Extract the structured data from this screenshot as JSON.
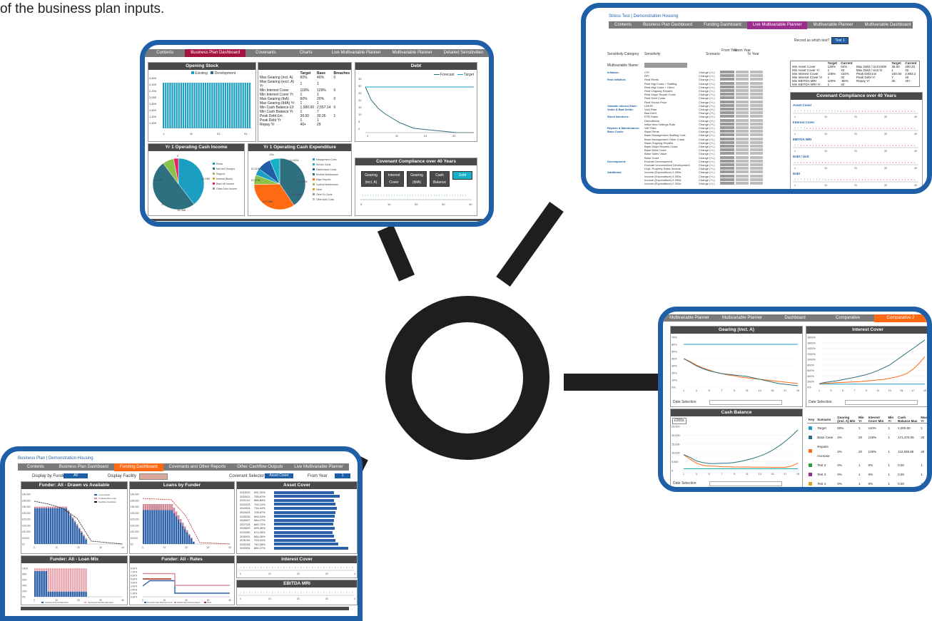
{
  "headline": "of the business plan inputs.",
  "colors": {
    "border": "#1f5fa8",
    "teal": "#1a8fa8",
    "orange": "#ff6a13",
    "dark": "#4a4a4a",
    "grey": "#7a7a7a",
    "pink": "#d98a95",
    "green": "#2e9e3e"
  },
  "card_dashboard": {
    "tabs": [
      "Contents",
      "Business Plan Dashboard",
      "Covenants",
      "Charts",
      "Live Multivariable Planner",
      "Multivariable Planner",
      "Detailed Sensitivities"
    ],
    "opening_stock": {
      "title": "Opening Stock",
      "legend": [
        "Existing",
        "Development"
      ],
      "y_ticks": [
        "2,600",
        "2,400",
        "2,200",
        "2,000",
        "1,800",
        "1,600",
        "1,400",
        "1,200"
      ],
      "x_ticks": [
        "1",
        "11",
        "21",
        "31"
      ]
    },
    "covenants": {
      "headers": [
        "Target",
        "Base",
        "Breaches"
      ],
      "rows": [
        [
          "Max Gearing (incl. A)",
          "60%",
          "40%",
          "0"
        ],
        [
          "Max Gearing (excl. A) Yr",
          "1",
          "1",
          ""
        ],
        [
          "Min Interest Cover",
          "110%",
          "129%",
          "0"
        ],
        [
          "Min Interest Cover Yr",
          "1",
          "1",
          ""
        ],
        [
          "Max Gearing (IbA)",
          "60%",
          "20%",
          "0"
        ],
        [
          "Max Gearing (IbfA) Yr",
          "1",
          "1",
          ""
        ],
        [
          "Min Cash Balance £0",
          "1,000.00",
          "2,557.14",
          "0"
        ],
        [
          "Min Cash Balance Yr",
          "1",
          "7",
          ""
        ],
        [
          "Peak Debt £m",
          "30.00",
          "30.26",
          "1"
        ],
        [
          "Peak Debt Yr",
          "1",
          "1",
          ""
        ],
        [
          "Repay Yr",
          "40+",
          "29",
          ""
        ]
      ]
    },
    "debt": {
      "title": "Debt",
      "legend": [
        "Forecast",
        "Target"
      ],
      "y_ticks": [
        "35",
        "30",
        "25",
        "20",
        "15",
        "10",
        "5",
        "0"
      ],
      "x_ticks": [
        "1",
        "11",
        "21",
        "31"
      ]
    },
    "income": {
      "title": "Yr 1 Operating Cash Income",
      "legend": [
        "Rents",
        "Net Net Charges",
        "Support",
        "Interest (Bank)",
        "Bank Mf Income",
        "Other Adm Income"
      ],
      "labels": [
        "2,207",
        "12,089",
        "15,368",
        "20",
        "0"
      ]
    },
    "expenditure": {
      "title": "Yr 1 Operating Cash Expenditure",
      "legend": [
        "Management Costs",
        "Service Costs",
        "Maintenance Costs",
        "Routine Maintenance",
        "Major Repairs",
        "Cyclical Maintenance",
        "Other",
        "Other Ex Costs",
        "Other Adm Costs"
      ],
      "labels": [
        "£1,600k",
        "£3,296k",
        "£2,318k",
        "£15,366k",
        "£12,889k",
        "£0k",
        "£2,378k"
      ]
    },
    "compliance": {
      "title": "Covenant Compliance over 40 Years",
      "buttons": [
        "Gearing (incl. A)",
        "Interest Cover",
        "Gearing (ibfA)",
        "Cash Balance",
        "Debt"
      ],
      "x_ticks": [
        "0",
        "10",
        "20",
        "30",
        "40"
      ]
    }
  },
  "card_stress": {
    "breadcrumb": "Stress Test",
    "org": "Demonstration Housing",
    "tabs": [
      "Contents",
      "Business Plan Dashboard",
      "Funding Dashboard",
      "Live Multivariable Planner",
      "Multivariable Planner",
      "Multivariable Dashboard"
    ],
    "record_label": "Record as which test?",
    "record_button": "Test 1",
    "col_headers": [
      "Sensitivity Category",
      "Sensitivity",
      "Scenario",
      "From Year",
      "From Year",
      "To Year"
    ],
    "multivariable_name": "Multivariable Name:",
    "sub_headers": [
      "Change 1",
      "Change 2",
      "Change 1 applied",
      "Change 2 applied"
    ],
    "categories": [
      {
        "cat": "Inflation:",
        "items": [
          "CPI",
          "RPI"
        ]
      },
      {
        "cat": "Real Inflation:",
        "items": [
          "Real Rents",
          "Real Mgt Costs + Staffing",
          "Real Mgt Costs + Other",
          "Real Ongoing Repairs",
          "Real Major Repair Costs",
          "Real Debt Costs",
          "Real House Price"
        ]
      },
      {
        "cat": "Variable Interest Rate:",
        "items": [
          "LIBOR"
        ]
      },
      {
        "cat": "Voids & Bad Debts:",
        "items": [
          "Void Rate",
          "Bad Debt"
        ]
      },
      {
        "cat": "Stock Numbers:",
        "items": [
          "RTB Sales",
          "Demolitions",
          "Initial New Lettings Rate"
        ]
      },
      {
        "cat": "Repairs & Maintenance:",
        "items": [
          "VAT Rate"
        ]
      },
      {
        "cat": "Base Costs:",
        "items": [
          "Base Rents",
          "Base Management Staffing Cost",
          "Base Management Other Costs",
          "Base Ongoing Repairs",
          "Base Major Repairs Costs",
          "Base Build Costs",
          "Base Sales Value",
          "Base Grant"
        ]
      },
      {
        "cat": "Development:",
        "items": [
          "Exclude Development",
          "Exclude Uncommitted Development",
          "Dvpt. Property Sales Income"
        ]
      },
      {
        "cat": "Additional",
        "items": [
          "Income (Expenditure) £ 000s",
          "Income (Expenditure) £ 000s",
          "Income (Expenditure) £ 000s",
          "Income (Expenditure) £ 000s"
        ]
      }
    ],
    "change_label": "Change (+/-)",
    "summary_headers": [
      "Target",
      "Current",
      "Target",
      "Current"
    ],
    "summary_rows": [
      [
        "Min Asset Cover",
        "125%",
        "54%",
        "Max Debt / Unit £000",
        "35.00",
        "300.20"
      ],
      [
        "Min Asset Cover Yr",
        "1",
        "40",
        "Max Debt / Unit Yr",
        "1",
        "40"
      ],
      [
        "Min Interest Cover",
        "105%",
        "434%",
        "Peak Debt £m",
        "150.00",
        "2,983.2"
      ],
      [
        "Min Interest Cover Yr",
        "1",
        "32",
        "Peak Debt Yr",
        "7",
        "40"
      ],
      [
        "Min EBITDA MRI",
        "100%",
        "-85%",
        "Repay Yr",
        "30",
        "40+"
      ],
      [
        "Min EBITDA MRI Yr",
        "1",
        "32",
        "",
        "",
        ""
      ]
    ],
    "compliance_title": "Covenant Compliance over 40 Years",
    "compliance_rows": [
      "Asset Cover",
      "Interest Cover",
      "EBITDA MRI",
      "Debt / Unit",
      "Debt"
    ],
    "x_ticks": [
      "1",
      "10",
      "20",
      "30",
      "40"
    ]
  },
  "card_funding": {
    "breadcrumb": "Business Plan",
    "org": "Demonstration Housing",
    "tabs": [
      "Contents",
      "Business Plan Dashboard",
      "Funding Dashboard",
      "Covenants and Other Reports",
      "Other Cashflow Outputs",
      "Live Multivariable Planner"
    ],
    "display_funder_label": "Display by Funder",
    "display_funder_value": "All",
    "display_facility_label": "Display Facility",
    "covenant_selector_label": "Covenant Selector",
    "covenant_selector_value": "Asset Cover",
    "from_year_label": "From Year",
    "from_year_value": "1",
    "panel1": {
      "title": "Funder: All - Drawn vs Available",
      "legend": [
        "Loan Drawn",
        "Undrawn/Net Loan",
        "Facilities Available"
      ],
      "y_ticks": [
        "£40,000",
        "£35,000",
        "£30,000",
        "£25,000",
        "£20,000",
        "£15,000",
        "£10,000",
        "£5,000",
        "£0"
      ]
    },
    "panel2": {
      "title": "Loans by Funder",
      "y_ticks": [
        "£40,000",
        "£35,000",
        "£30,000",
        "£25,000",
        "£20,000",
        "£15,000",
        "£10,000",
        "£5,000",
        "£0"
      ]
    },
    "asset_cover": {
      "title": "Asset Cover",
      "rows": [
        [
          "2019/20",
          "691.20%"
        ],
        [
          "2020/21",
          "755.87%"
        ],
        [
          "2021/22",
          "686.85%"
        ],
        [
          "2022/23",
          "704.21%"
        ],
        [
          "2023/24",
          "716.44%"
        ],
        [
          "2024/25",
          "705.87%"
        ],
        [
          "2025/26",
          "694.24%"
        ],
        [
          "2026/27",
          "684.27%"
        ],
        [
          "2027/28",
          "680.73%"
        ],
        [
          "2028/29",
          "695.28%"
        ],
        [
          "2029/30",
          "674.28%"
        ],
        [
          "2030/31",
          "684.28%"
        ],
        [
          "2031/32",
          "703.31%"
        ],
        [
          "2032/33",
          "740.28%"
        ],
        [
          "2033/34",
          "850.27%"
        ]
      ]
    },
    "panel3": {
      "title": "Funder: All - Loan Mix",
      "y_ticks": [
        "100%",
        "80%",
        "60%",
        "40%",
        "20%",
        "0%"
      ],
      "legend": [
        "Opening All Fixed Rate Debt",
        "Opening All Variable Rate Debt"
      ]
    },
    "panel4": {
      "title": "Funder: All - Rates",
      "y_ticks": [
        "8.00%",
        "7.00%",
        "6.00%",
        "5.00%",
        "4.00%",
        "3.00%",
        "2.00%",
        "1.00%",
        "0.00%"
      ],
      "legend": [
        "Fixed Rate Debt Wtd Avg Interest",
        "Variable Rate Debt Avg Margin",
        "WCR"
      ]
    },
    "interest_cover": {
      "title": "Interest Cover"
    },
    "ebitda": {
      "title": "EBITDA MRI"
    },
    "x_ticks": [
      "0",
      "10",
      "20",
      "30",
      "40"
    ]
  },
  "card_compare": {
    "tabs": [
      "Multivariable Planner",
      "Multivariable Planner",
      "Dashboard",
      "Comparative",
      "Comparative 2"
    ],
    "gearing": {
      "title": "Gearing (incl. A)",
      "y_ticks": [
        "70%",
        "60%",
        "50%",
        "40%",
        "30%",
        "20%",
        "10%",
        "0%"
      ],
      "x_ticks": [
        "1",
        "3",
        "5",
        "7",
        "9",
        "11",
        "13",
        "15",
        "17",
        "19"
      ]
    },
    "interest": {
      "title": "Interest Cover",
      "y_ticks": [
        "1800%",
        "1600%",
        "1400%",
        "1200%",
        "1000%",
        "800%",
        "600%",
        "400%",
        "200%",
        "0%"
      ],
      "x_ticks": [
        "1",
        "3",
        "5",
        "7",
        "9",
        "11",
        "13",
        "15",
        "17",
        "19"
      ]
    },
    "cash": {
      "title": "Cash Balance",
      "badge": "£000s",
      "y_ticks": [
        "25,000",
        "20,000",
        "15,000",
        "10,000",
        "5,000",
        "0"
      ],
      "x_ticks": [
        "1",
        "3",
        "5",
        "7",
        "9",
        "11",
        "13",
        "15",
        "17",
        "19"
      ]
    },
    "date_selection": "Date Selection",
    "table_headers": [
      "Key",
      "Scenario",
      "Gearing (incl. A) Min",
      "Min Yr",
      "Interest Cover Min",
      "Min Yr",
      "Cash Balance Max",
      "Max Yr"
    ],
    "table_rows": [
      {
        "color": "#1a9ec2",
        "cells": [
          "Target",
          "60%",
          "1",
          "110%",
          "1",
          "1,000.00",
          "1"
        ]
      },
      {
        "color": "#2e6f80",
        "cells": [
          "Base Case",
          "2%",
          "20",
          "129%",
          "1",
          "171,470.05",
          "40"
        ]
      },
      {
        "color": "#ff6a13",
        "cells": [
          "Repairs Increase",
          "2%",
          "20",
          "129%",
          "1",
          "112,608.95",
          "40"
        ]
      },
      {
        "color": "#2e9e3e",
        "cells": [
          "Test 2",
          "0%",
          "1",
          "0%",
          "1",
          "0.00",
          "1"
        ]
      },
      {
        "color": "#9b2d8f",
        "cells": [
          "Test 3",
          "0%",
          "1",
          "0%",
          "1",
          "0.00",
          "1"
        ]
      },
      {
        "color": "#e0a020",
        "cells": [
          "Test 4",
          "0%",
          "1",
          "0%",
          "1",
          "0.00",
          "1"
        ]
      }
    ]
  }
}
